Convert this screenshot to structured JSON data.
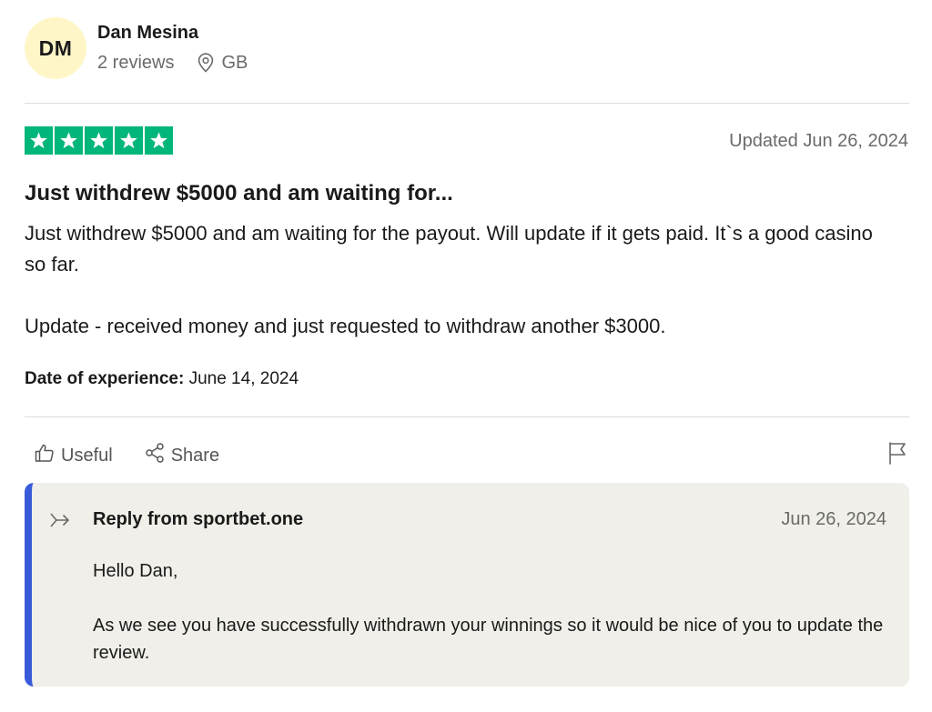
{
  "reviewer": {
    "initials": "DM",
    "name": "Dan Mesina",
    "reviews_count": "2 reviews",
    "country": "GB"
  },
  "review": {
    "rating": 5,
    "star_color": "#00b67a",
    "updated": "Updated Jun 26, 2024",
    "title": "Just withdrew $5000 and am waiting for...",
    "body_paragraph_1": "Just withdrew $5000 and am waiting for the payout. Will update if it gets paid. It`s a good casino so far.",
    "body_paragraph_2": "Update - received money and just requested to withdraw another $3000.",
    "experience_label": "Date of experience:",
    "experience_date": " June 14, 2024"
  },
  "actions": {
    "useful_label": "Useful",
    "share_label": "Share"
  },
  "reply": {
    "accent_color": "#3a5bd9",
    "header": "Reply from sportbet.one",
    "date": "Jun 26, 2024",
    "greeting": "Hello Dan,",
    "message": "As we see you have successfully withdrawn your winnings so it would be nice of you to update the review."
  }
}
